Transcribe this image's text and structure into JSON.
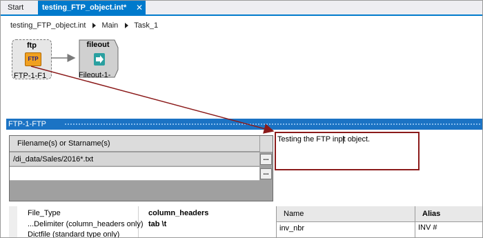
{
  "tabs": [
    {
      "label": "Start"
    },
    {
      "label": "testing_FTP_object.int*",
      "close_glyph": "✕"
    }
  ],
  "breadcrumb": [
    "testing_FTP_object.int",
    "Main",
    "Task_1"
  ],
  "canvas": {
    "nodes": [
      {
        "title": "ftp",
        "label": "FTP-1-F1",
        "icon_text": "FTP",
        "icon": "ftp-folder-icon"
      },
      {
        "title": "fileout",
        "label": "Fileout-1-",
        "icon": "fileout-arrow-icon"
      }
    ]
  },
  "section": {
    "title": "FTP-1-FTP"
  },
  "filegrid": {
    "header": "Filename(s) or Starname(s)",
    "rows": [
      "/di_data/Sales/2016*.txt",
      ""
    ],
    "button_label": "..."
  },
  "description": {
    "before_caret": "Testing the FTP inp",
    "after_caret": "t object."
  },
  "properties": [
    {
      "name": "File_Type",
      "value": "column_headers"
    },
    {
      "name": "...Delimiter (column_headers only)",
      "value": "tab \\t"
    },
    {
      "name": "Dictfile (standard type only)",
      "value": ""
    }
  ],
  "columns": {
    "headers": [
      "Name",
      "Alias"
    ],
    "rows": [
      {
        "name": "inv_nbr",
        "alias": "INV #"
      }
    ]
  },
  "colors": {
    "accent": "#007acc",
    "section": "#1b73c4",
    "annotation": "#8b1a1a"
  }
}
